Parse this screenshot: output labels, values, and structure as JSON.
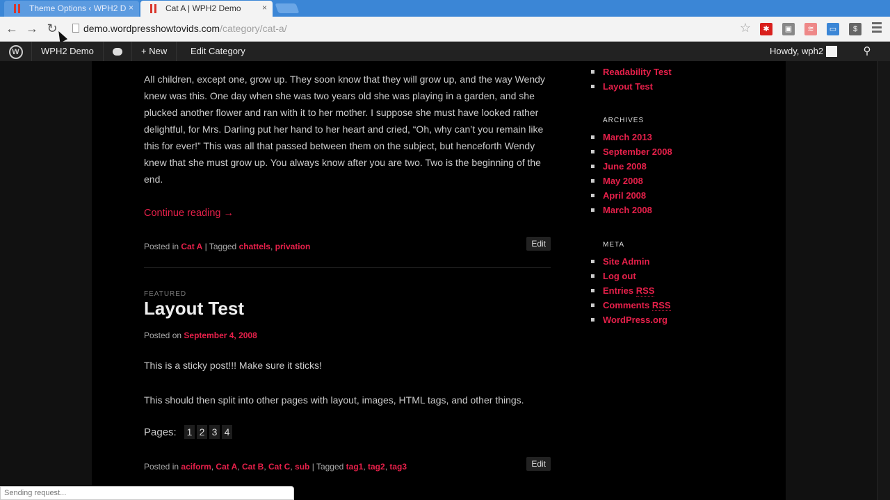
{
  "browser": {
    "tabs": [
      {
        "title": "Theme Options ‹ WPH2 D",
        "close": "×"
      },
      {
        "title": "Cat A | WPH2 Demo",
        "close": "×"
      }
    ],
    "url_host": "demo.wordpresshowtovids.com",
    "url_path": "/category/cat-a/",
    "status_text": "Sending request..."
  },
  "adminbar": {
    "logo": "W",
    "site": "WPH2 Demo",
    "new": "+ New",
    "edit_category": "Edit Category",
    "howdy": "Howdy, wph2"
  },
  "post1": {
    "body": "All children, except one, grow up. They soon know that they will grow up, and the way Wendy knew was this. One day when she was two years old she was playing in a garden, and she plucked another flower and ran with it to her mother. I suppose she must have looked rather delightful, for Mrs. Darling put her hand to her heart and cried, “Oh, why can’t you remain like this for ever!” This was all that passed between them on the subject, but henceforth Wendy knew that she must grow up. You always know after you are two. Two is the beginning of the end.",
    "continue": "Continue reading →",
    "posted_in": "Posted in",
    "category": "Cat A",
    "tagged": "| Tagged",
    "tags": [
      "chattels",
      "privation"
    ],
    "edit": "Edit"
  },
  "post2": {
    "featured": "FEATURED",
    "title": "Layout Test",
    "posted_on": "Posted on",
    "date": "September 4, 2008",
    "sticky": "This is a sticky post!!! Make sure it sticks!",
    "split": "This should then split into other pages with layout, images, HTML tags, and other things.",
    "pages_label": "Pages:",
    "pages": [
      "1",
      "2",
      "3",
      "4"
    ],
    "posted_in": "Posted in",
    "categories": [
      "aciform",
      "Cat A",
      "Cat B",
      "Cat C",
      "sub"
    ],
    "tagged": "| Tagged",
    "tags": [
      "tag1",
      "tag2",
      "tag3"
    ],
    "edit": "Edit"
  },
  "sidebar": {
    "recent": [
      "Readability Test",
      "Layout Test"
    ],
    "archives_title": "ARCHIVES",
    "archives": [
      "March 2013",
      "September 2008",
      "June 2008",
      "May 2008",
      "April 2008",
      "March 2008"
    ],
    "meta_title": "META",
    "meta": {
      "site_admin": "Site Admin",
      "log_out": "Log out",
      "entries": "Entries",
      "comments": "Comments",
      "rss": "RSS",
      "wordpress": "WordPress.org"
    }
  },
  "colors": {
    "accent": "#e6204a",
    "background": "#000000",
    "adminbar": "#222222"
  }
}
